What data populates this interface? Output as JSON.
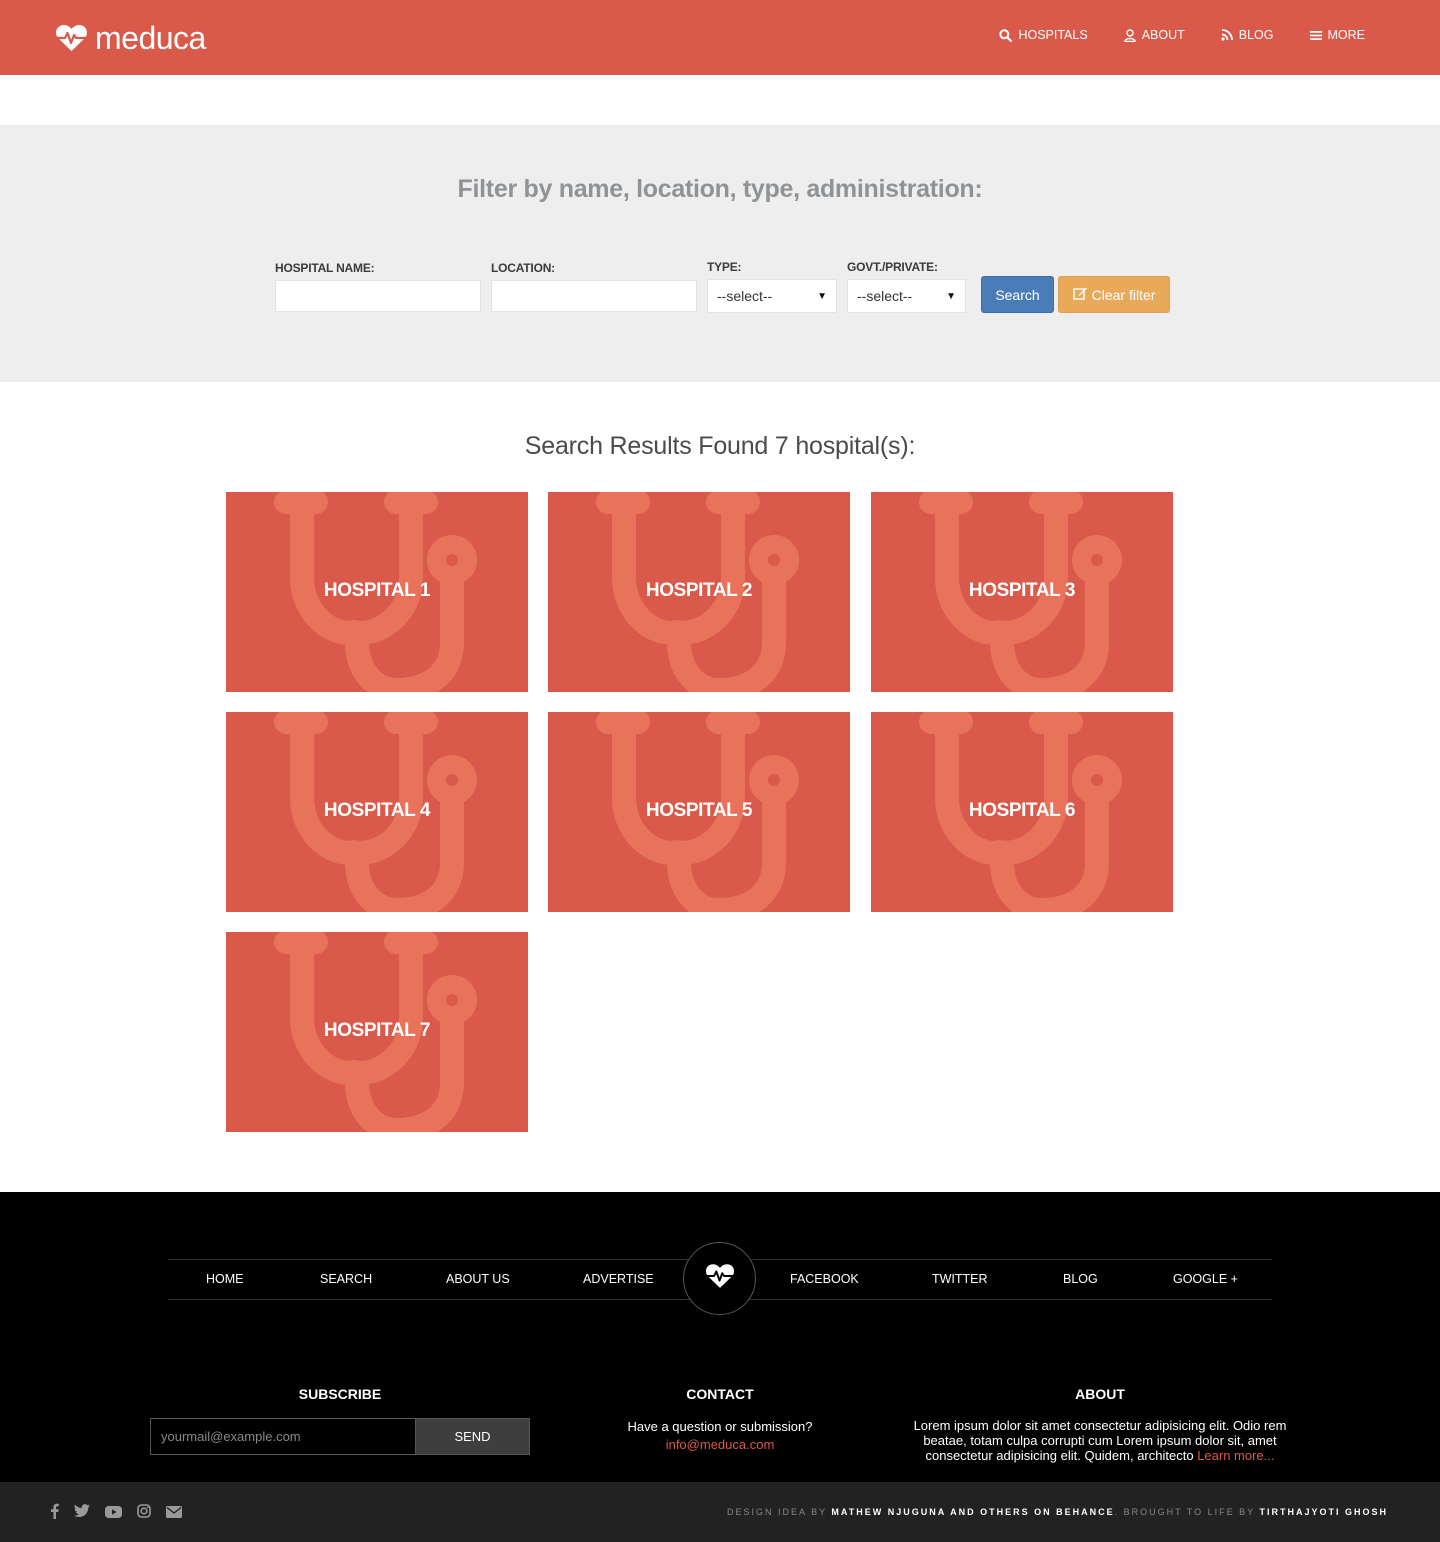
{
  "header": {
    "brand": "meduca",
    "nav": [
      {
        "label": "HOSPITALS",
        "icon": "search-icon"
      },
      {
        "label": "ABOUT",
        "icon": "user-icon"
      },
      {
        "label": "BLOG",
        "icon": "rss-icon"
      },
      {
        "label": "MORE",
        "icon": "menu-icon"
      }
    ],
    "colors": {
      "brand": "#d9594a"
    }
  },
  "filter": {
    "title": "Filter by name, location, type, administration:",
    "hospital_name_label": "HOSPITAL NAME:",
    "hospital_name_value": "",
    "location_label": "LOCATION:",
    "location_value": "",
    "type_label": "TYPE:",
    "type_selected": "--select--",
    "admin_label": "GOVT./PRIVATE:",
    "admin_selected": "--select--",
    "search_button": "Search",
    "clear_button": "Clear filter",
    "colors": {
      "search": "#4a7db8",
      "clear": "#e9a95a"
    }
  },
  "results": {
    "title": "Search Results Found 7 hospital(s):",
    "hospitals": [
      "HOSPITAL 1",
      "HOSPITAL 2",
      "HOSPITAL 3",
      "HOSPITAL 4",
      "HOSPITAL 5",
      "HOSPITAL 6",
      "HOSPITAL 7"
    ],
    "card_icon": "stethoscope-icon"
  },
  "footer": {
    "nav_left": [
      "HOME",
      "SEARCH",
      "ABOUT US",
      "ADVERTISE"
    ],
    "nav_right": [
      "FACEBOOK",
      "TWITTER",
      "BLOG",
      "GOOGLE +"
    ],
    "center_icon": "heartbeat-icon",
    "subscribe": {
      "title": "SUBSCRIBE",
      "placeholder": "yourmail@example.com",
      "button": "SEND"
    },
    "contact": {
      "title": "CONTACT",
      "text": "Have a question or submission?",
      "email": "info@meduca.com"
    },
    "about": {
      "title": "ABOUT",
      "text": "Lorem ipsum dolor sit amet consectetur adipisicing elit. Odio rem beatae, totam culpa corrupti cum Lorem ipsum dolor sit, amet consectetur adipisicing elit. Quidem, architecto",
      "link": "Learn more..."
    },
    "socials": [
      "facebook-icon",
      "twitter-icon",
      "youtube-icon",
      "instagram-icon",
      "envelope-icon"
    ],
    "credits": {
      "prefix": "DESIGN IDEA BY",
      "author1": "MATHEW NJUGUNA AND OTHERS ON BEHANCE",
      "middle": ". BROUGHT TO LIFE BY",
      "author2": "TIRTHAJYOTI GHOSH"
    }
  }
}
